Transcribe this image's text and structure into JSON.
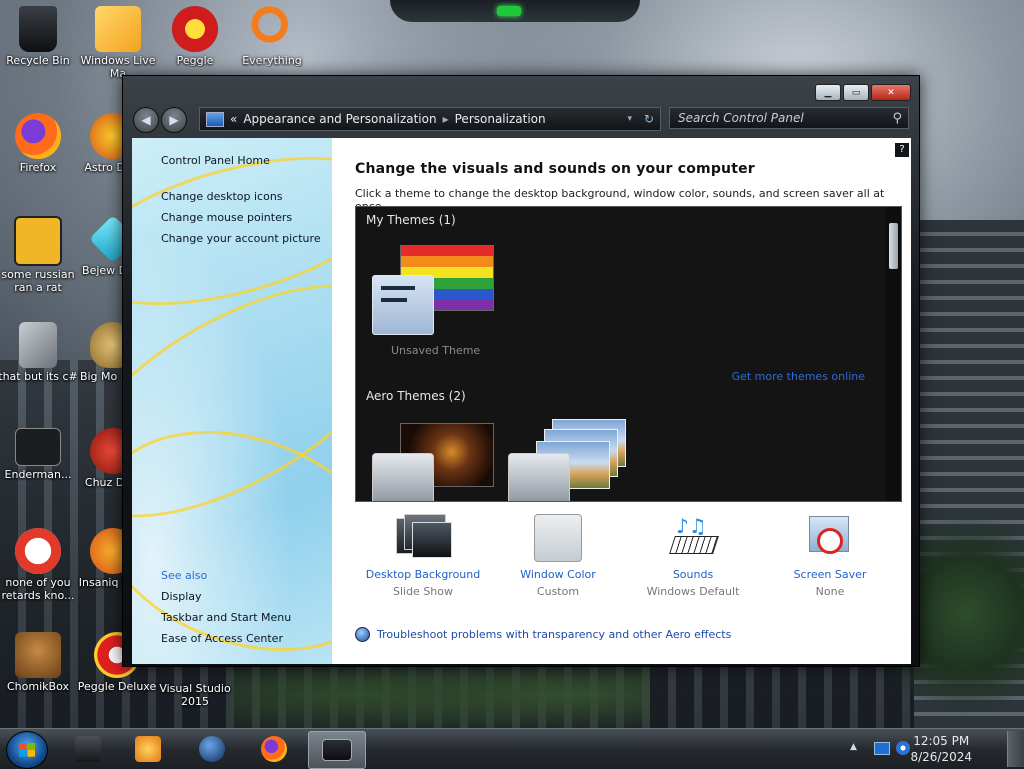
{
  "desktop": {
    "icons": [
      {
        "label": "Recycle Bin"
      },
      {
        "label": "Windows Live Ma"
      },
      {
        "label": "Peggle"
      },
      {
        "label": "Everything"
      },
      {
        "label": "Firefox"
      },
      {
        "label": "Astro Delu"
      },
      {
        "label": "some russian ran a rat"
      },
      {
        "label": "Bejew Delu"
      },
      {
        "label": "that but its c#"
      },
      {
        "label": "Big Mo Delu"
      },
      {
        "label": "Enderman..."
      },
      {
        "label": "Chuz Delu"
      },
      {
        "label": "none of you retards kno..."
      },
      {
        "label": "Insaniq Delu"
      },
      {
        "label": "ChomikBox"
      },
      {
        "label": "Peggle Deluxe"
      },
      {
        "label": "Visual Studio 2015"
      }
    ]
  },
  "window": {
    "nav": {
      "back_icon": "◀",
      "forward_icon": "▶",
      "breadcrumb_root_sep": "«",
      "breadcrumb": [
        "Appearance and Personalization",
        "Personalization"
      ],
      "crumb_sep": "▸",
      "dropdown_icon": "▾",
      "refresh_icon": "↻",
      "search_placeholder": "Search Control Panel",
      "search_icon": "⚲"
    },
    "controls": {
      "minimize": "▁",
      "maximize": "▭",
      "close": "✕"
    },
    "sidebar": {
      "home": "Control Panel Home",
      "links": [
        "Change desktop icons",
        "Change mouse pointers",
        "Change your account picture"
      ],
      "see_also_title": "See also",
      "see_also": [
        "Display",
        "Taskbar and Start Menu",
        "Ease of Access Center"
      ]
    },
    "main": {
      "help_icon": "?",
      "title": "Change the visuals and sounds on your computer",
      "subtitle": "Click a theme to change the desktop background, window color, sounds, and screen saver all at once.",
      "groups": {
        "my_themes": "My Themes (1)",
        "aero_themes": "Aero Themes (2)"
      },
      "unsaved_theme": "Unsaved Theme",
      "get_more": "Get more themes online",
      "options": [
        {
          "label": "Desktop Background",
          "value": "Slide Show"
        },
        {
          "label": "Window Color",
          "value": "Custom"
        },
        {
          "label": "Sounds",
          "value": "Windows Default"
        },
        {
          "label": "Screen Saver",
          "value": "None"
        }
      ],
      "troubleshoot": "Troubleshoot problems with transparency and other Aero effects"
    }
  },
  "taskbar": {
    "clock_time": "12:05 PM",
    "clock_date": "8/26/2024",
    "tray_arrow": "▲"
  },
  "colors": {
    "link": "#2161c8",
    "accent_orange": "#f28a1c"
  }
}
